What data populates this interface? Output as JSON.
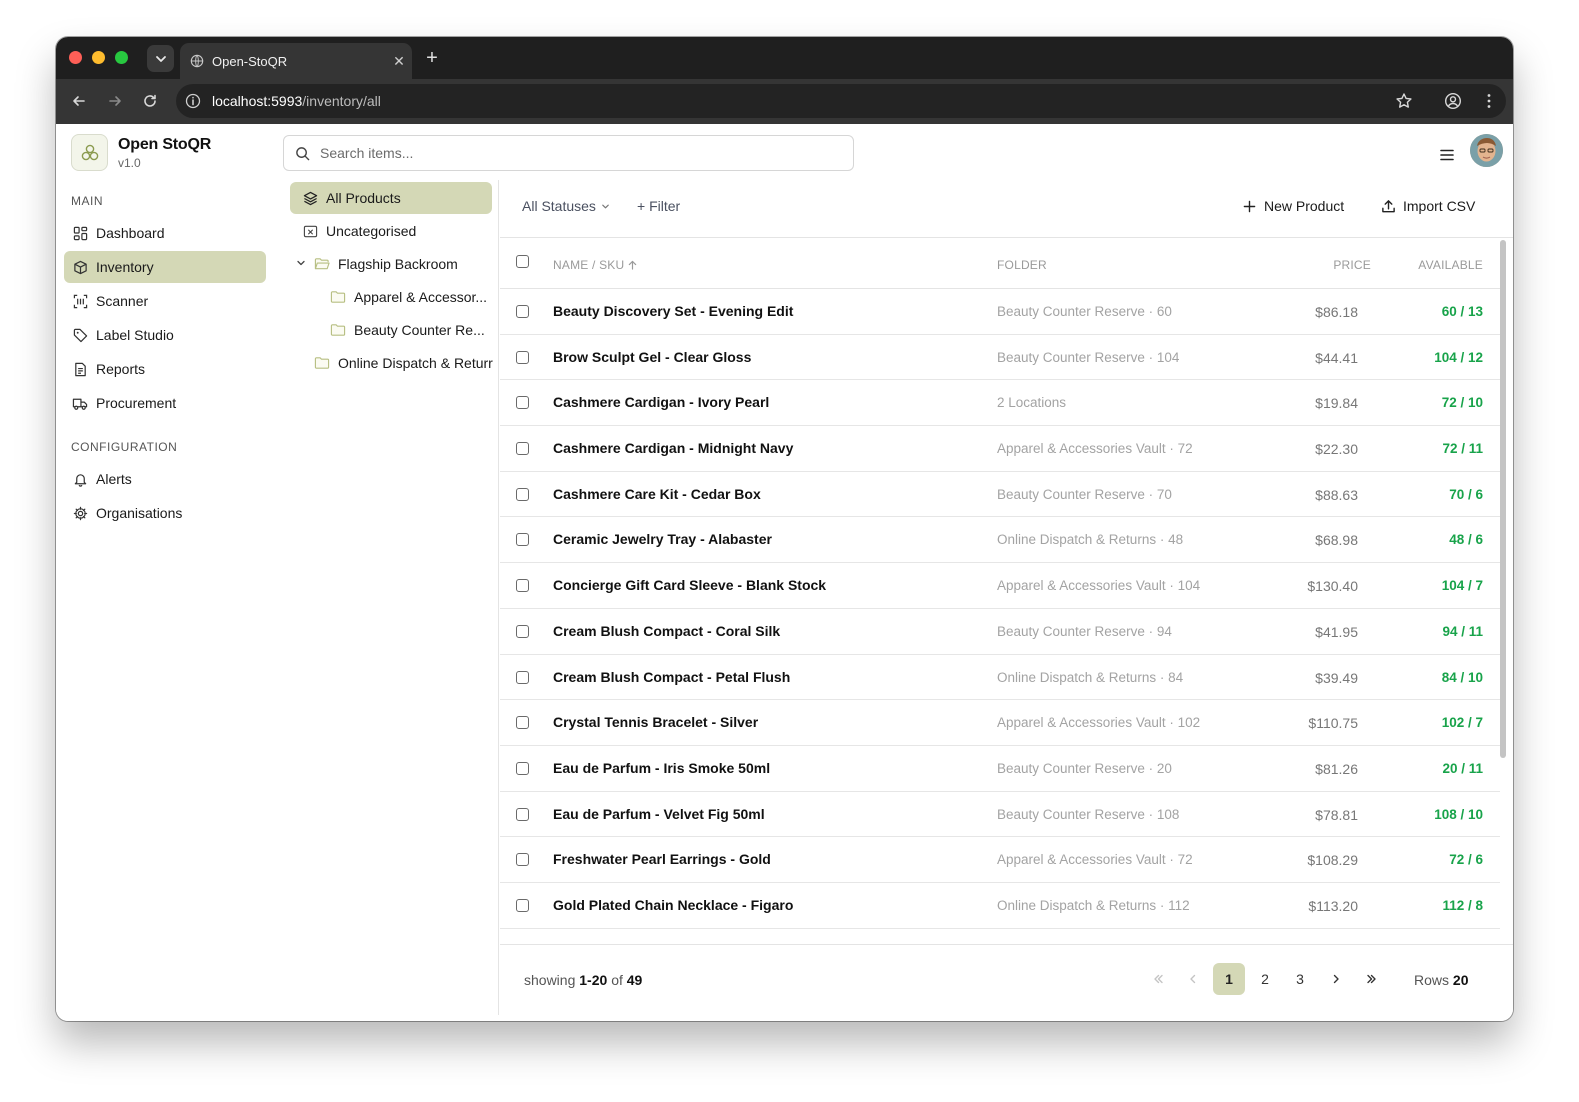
{
  "browser": {
    "tab_title": "Open-StoQR",
    "url_host": "localhost:5993",
    "url_path": "/inventory/all"
  },
  "brand": {
    "name": "Open StoQR",
    "version": "v1.0"
  },
  "sidebar": {
    "main_label": "MAIN",
    "main_items": [
      {
        "label": "Dashboard",
        "icon": "dashboard-icon"
      },
      {
        "label": "Inventory",
        "icon": "box-icon"
      },
      {
        "label": "Scanner",
        "icon": "scanner-icon"
      },
      {
        "label": "Label Studio",
        "icon": "tag-icon"
      },
      {
        "label": "Reports",
        "icon": "document-icon"
      },
      {
        "label": "Procurement",
        "icon": "truck-icon"
      }
    ],
    "config_label": "CONFIGURATION",
    "config_items": [
      {
        "label": "Alerts",
        "icon": "bell-icon"
      },
      {
        "label": "Organisations",
        "icon": "gear-icon"
      }
    ]
  },
  "search": {
    "placeholder": "Search items..."
  },
  "tree": {
    "all_products": "All Products",
    "uncategorised": "Uncategorised",
    "flagship": "Flagship Backroom",
    "apparel": "Apparel & Accessor...",
    "beauty": "Beauty Counter Re...",
    "online": "Online Dispatch & Returr"
  },
  "filters": {
    "status": "All Statuses",
    "filter": "+ Filter",
    "new_product": "New Product",
    "import_csv": "Import CSV"
  },
  "table": {
    "headers": {
      "name": "NAME / SKU",
      "folder": "FOLDER",
      "price": "PRICE",
      "available": "AVAILABLE"
    },
    "rows": [
      {
        "name": "Beauty Discovery Set - Evening Edit",
        "folder": "Beauty Counter Reserve · 60",
        "price": "$86.18",
        "available": "60 / 13"
      },
      {
        "name": "Brow Sculpt Gel - Clear Gloss",
        "folder": "Beauty Counter Reserve · 104",
        "price": "$44.41",
        "available": "104 / 12"
      },
      {
        "name": "Cashmere Cardigan - Ivory Pearl",
        "folder": "2 Locations",
        "price": "$19.84",
        "available": "72 / 10"
      },
      {
        "name": "Cashmere Cardigan - Midnight Navy",
        "folder": "Apparel & Accessories Vault · 72",
        "price": "$22.30",
        "available": "72 / 11"
      },
      {
        "name": "Cashmere Care Kit - Cedar Box",
        "folder": "Beauty Counter Reserve · 70",
        "price": "$88.63",
        "available": "70 / 6"
      },
      {
        "name": "Ceramic Jewelry Tray - Alabaster",
        "folder": "Online Dispatch & Returns · 48",
        "price": "$68.98",
        "available": "48 / 6"
      },
      {
        "name": "Concierge Gift Card Sleeve - Blank Stock",
        "folder": "Apparel & Accessories Vault · 104",
        "price": "$130.40",
        "available": "104 / 7"
      },
      {
        "name": "Cream Blush Compact - Coral Silk",
        "folder": "Beauty Counter Reserve · 94",
        "price": "$41.95",
        "available": "94 / 11"
      },
      {
        "name": "Cream Blush Compact - Petal Flush",
        "folder": "Online Dispatch & Returns · 84",
        "price": "$39.49",
        "available": "84 / 10"
      },
      {
        "name": "Crystal Tennis Bracelet - Silver",
        "folder": "Apparel & Accessories Vault · 102",
        "price": "$110.75",
        "available": "102 / 7"
      },
      {
        "name": "Eau de Parfum - Iris Smoke 50ml",
        "folder": "Beauty Counter Reserve · 20",
        "price": "$81.26",
        "available": "20 / 11"
      },
      {
        "name": "Eau de Parfum - Velvet Fig 50ml",
        "folder": "Beauty Counter Reserve · 108",
        "price": "$78.81",
        "available": "108 / 10"
      },
      {
        "name": "Freshwater Pearl Earrings - Gold",
        "folder": "Apparel & Accessories Vault · 72",
        "price": "$108.29",
        "available": "72 / 6"
      },
      {
        "name": "Gold Plated Chain Necklace - Figaro",
        "folder": "Online Dispatch & Returns · 112",
        "price": "$113.20",
        "available": "112 / 8"
      }
    ]
  },
  "pagination": {
    "showing_prefix": "showing",
    "range": "1-20",
    "of": "of",
    "total": "49",
    "pages": [
      "1",
      "2",
      "3"
    ],
    "rows_label": "Rows",
    "rows_value": "20"
  },
  "colors": {
    "accent": "#d4d8b6",
    "available_green": "#18a34a"
  }
}
